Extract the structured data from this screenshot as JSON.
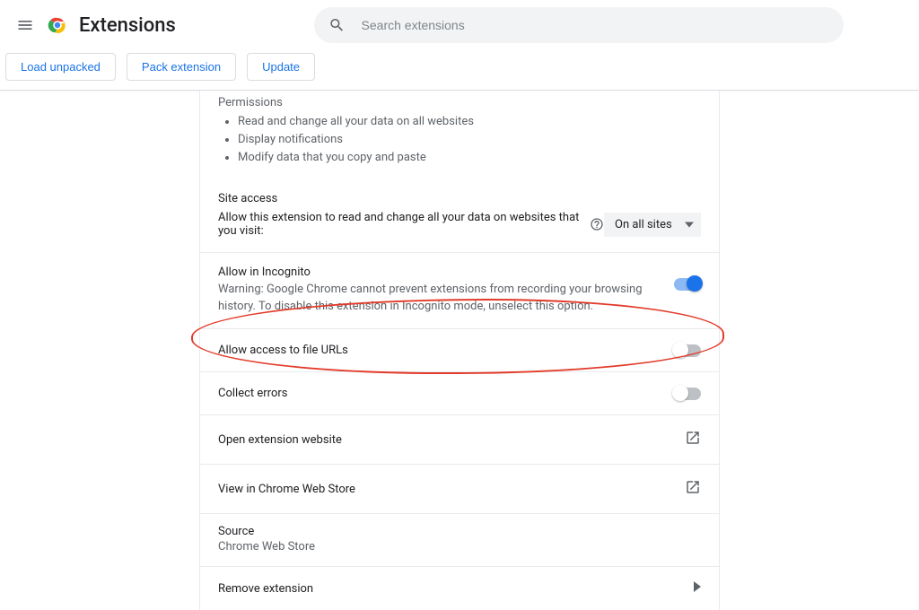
{
  "header": {
    "title": "Extensions",
    "search_placeholder": "Search extensions"
  },
  "toolbar": {
    "load_unpacked": "Load unpacked",
    "pack_extension": "Pack extension",
    "update": "Update"
  },
  "card": {
    "permissions": {
      "title": "Permissions",
      "items": [
        "Read and change all your data on all websites",
        "Display notifications",
        "Modify data that you copy and paste"
      ]
    },
    "site_access": {
      "heading": "Site access",
      "prompt": "Allow this extension to read and change all your data on websites that you visit:",
      "selected": "On all sites"
    },
    "incognito": {
      "title": "Allow in Incognito",
      "desc": "Warning: Google Chrome cannot prevent extensions from recording your browsing history. To disable this extension in Incognito mode, unselect this option.",
      "enabled": true
    },
    "file_urls": {
      "title": "Allow access to file URLs",
      "enabled": false
    },
    "collect_errors": {
      "title": "Collect errors",
      "enabled": false
    },
    "open_site": "Open extension website",
    "view_store": "View in Chrome Web Store",
    "source": {
      "label": "Source",
      "value": "Chrome Web Store"
    },
    "remove": "Remove extension"
  }
}
